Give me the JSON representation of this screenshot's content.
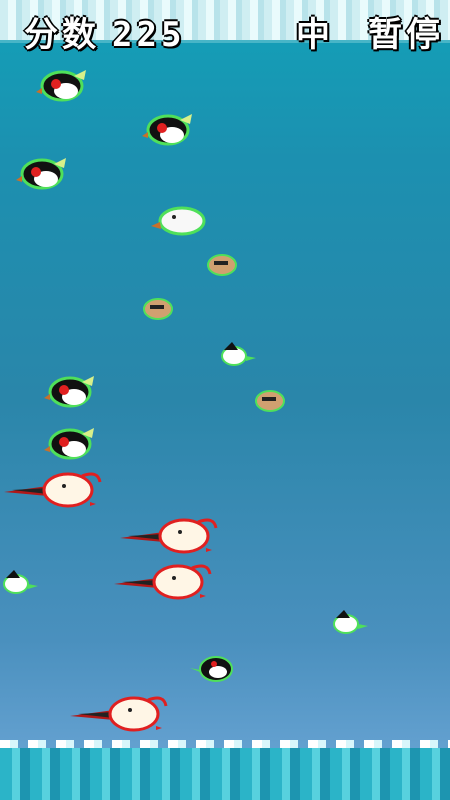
{
  "hud": {
    "score_label": "分数",
    "score_value": "225",
    "level_label": "中",
    "pause_label": "暂停"
  },
  "colors": {
    "sky_top": "#12a1b8",
    "sky_bottom": "#6fa8d8",
    "sea": "#2bb4c8"
  },
  "sprites": [
    {
      "type": "penguin-rockhopper",
      "icon": "penguin-rockhopper-icon"
    },
    {
      "type": "penguin-rockhopper",
      "icon": "penguin-rockhopper-icon"
    },
    {
      "type": "penguin-rockhopper",
      "icon": "penguin-rockhopper-icon"
    },
    {
      "type": "white-bird",
      "icon": "white-bird-icon"
    },
    {
      "type": "small-brown-bird",
      "icon": "small-brown-bird-icon"
    },
    {
      "type": "small-brown-bird",
      "icon": "small-brown-bird-icon"
    },
    {
      "type": "small-black-white-bird",
      "icon": "small-black-white-bird-icon"
    },
    {
      "type": "penguin-rockhopper",
      "icon": "penguin-rockhopper-icon"
    },
    {
      "type": "small-brown-bird",
      "icon": "small-brown-bird-icon"
    },
    {
      "type": "penguin-rockhopper",
      "icon": "penguin-rockhopper-icon"
    },
    {
      "type": "long-beak-bird",
      "icon": "long-beak-bird-icon"
    },
    {
      "type": "small-black-white-bird",
      "icon": "small-black-white-bird-icon"
    },
    {
      "type": "long-beak-bird",
      "icon": "long-beak-bird-icon"
    },
    {
      "type": "long-beak-bird",
      "icon": "long-beak-bird-icon"
    },
    {
      "type": "small-black-white-bird",
      "icon": "small-black-white-bird-icon"
    },
    {
      "type": "penguin-small",
      "icon": "penguin-small-icon"
    },
    {
      "type": "long-beak-bird",
      "icon": "long-beak-bird-icon"
    }
  ]
}
